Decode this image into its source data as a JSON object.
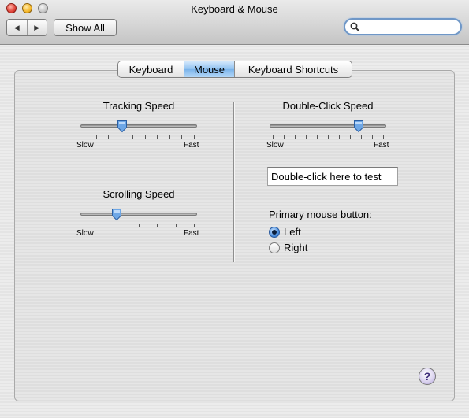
{
  "window": {
    "title": "Keyboard & Mouse"
  },
  "toolbar": {
    "back_icon": "◀",
    "forward_icon": "▶",
    "show_all_label": "Show All",
    "search_value": "",
    "search_placeholder": ""
  },
  "tabs": [
    {
      "label": "Keyboard",
      "selected": false
    },
    {
      "label": "Mouse",
      "selected": true
    },
    {
      "label": "Keyboard Shortcuts",
      "selected": false
    }
  ],
  "tracking_speed": {
    "title": "Tracking Speed",
    "min_label": "Slow",
    "max_label": "Fast",
    "level": 0.35,
    "ticks": 10
  },
  "scrolling_speed": {
    "title": "Scrolling Speed",
    "min_label": "Slow",
    "max_label": "Fast",
    "level": 0.3,
    "ticks": 7
  },
  "double_click_speed": {
    "title": "Double-Click Speed",
    "min_label": "Slow",
    "max_label": "Fast",
    "level": 0.78,
    "ticks": 11
  },
  "double_click_test": {
    "text": "Double-click here to test"
  },
  "primary_mouse_button": {
    "label": "Primary mouse button:",
    "options": [
      {
        "label": "Left",
        "selected": true
      },
      {
        "label": "Right",
        "selected": false
      }
    ]
  },
  "help": {
    "label": "?"
  },
  "colors": {
    "accent": "#7ab3ea",
    "knob": "#6ea7e6"
  }
}
